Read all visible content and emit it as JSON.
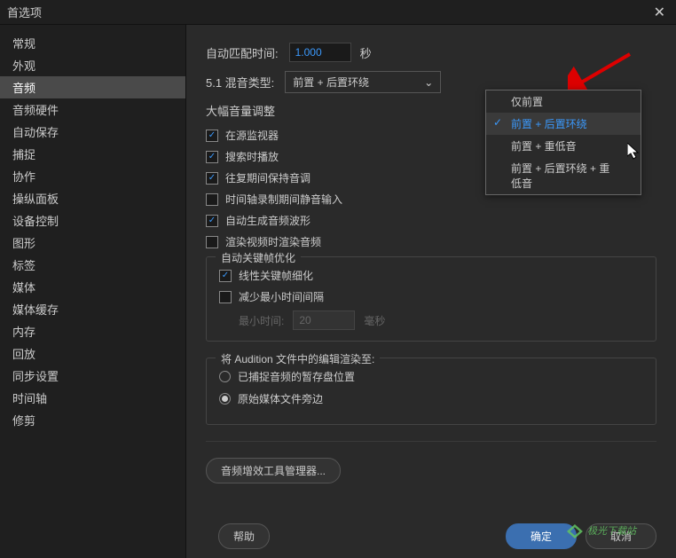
{
  "window": {
    "title": "首选项"
  },
  "sidebar": {
    "items": [
      {
        "label": "常规"
      },
      {
        "label": "外观"
      },
      {
        "label": "音频"
      },
      {
        "label": "音频硬件"
      },
      {
        "label": "自动保存"
      },
      {
        "label": "捕捉"
      },
      {
        "label": "协作"
      },
      {
        "label": "操纵面板"
      },
      {
        "label": "设备控制"
      },
      {
        "label": "图形"
      },
      {
        "label": "标签"
      },
      {
        "label": "媒体"
      },
      {
        "label": "媒体缓存"
      },
      {
        "label": "内存"
      },
      {
        "label": "回放"
      },
      {
        "label": "同步设置"
      },
      {
        "label": "时间轴"
      },
      {
        "label": "修剪"
      }
    ],
    "active_index": 2
  },
  "content": {
    "auto_match_label": "自动匹配时间:",
    "auto_match_value": "1.000",
    "auto_match_unit": "秒",
    "mix_type_label": "5.1 混音类型:",
    "mix_type_selected": "前置 + 后置环绕",
    "mix_options": [
      "仅前置",
      "前置 + 后置环绕",
      "前置 + 重低音",
      "前置 + 后置环绕 + 重低音"
    ],
    "volume_adjust_label": "大幅音量调整",
    "checks": [
      {
        "label": "在源监视器",
        "checked": true
      },
      {
        "label": "搜索时播放",
        "checked": true
      },
      {
        "label": "往复期间保持音调",
        "checked": true
      },
      {
        "label": "时间轴录制期间静音输入",
        "checked": false
      },
      {
        "label": "自动生成音频波形",
        "checked": true
      },
      {
        "label": "渲染视频时渲染音频",
        "checked": false
      }
    ],
    "keyframe_group": {
      "title": "自动关键帧优化",
      "linear": {
        "label": "线性关键帧细化",
        "checked": true
      },
      "reduce": {
        "label": "减少最小时间间隔",
        "checked": false
      },
      "min_time_label": "最小时间:",
      "min_time_value": "20",
      "min_time_unit": "毫秒"
    },
    "audition_group": {
      "title": "将 Audition 文件中的编辑渲染至:",
      "options": [
        {
          "label": "已捕捉音频的暂存盘位置",
          "selected": false
        },
        {
          "label": "原始媒体文件旁边",
          "selected": true
        }
      ]
    },
    "fx_manager_button": "音频增效工具管理器...",
    "buttons": {
      "help": "帮助",
      "ok": "确定",
      "cancel": "取消"
    }
  },
  "watermark": "极光下载站"
}
